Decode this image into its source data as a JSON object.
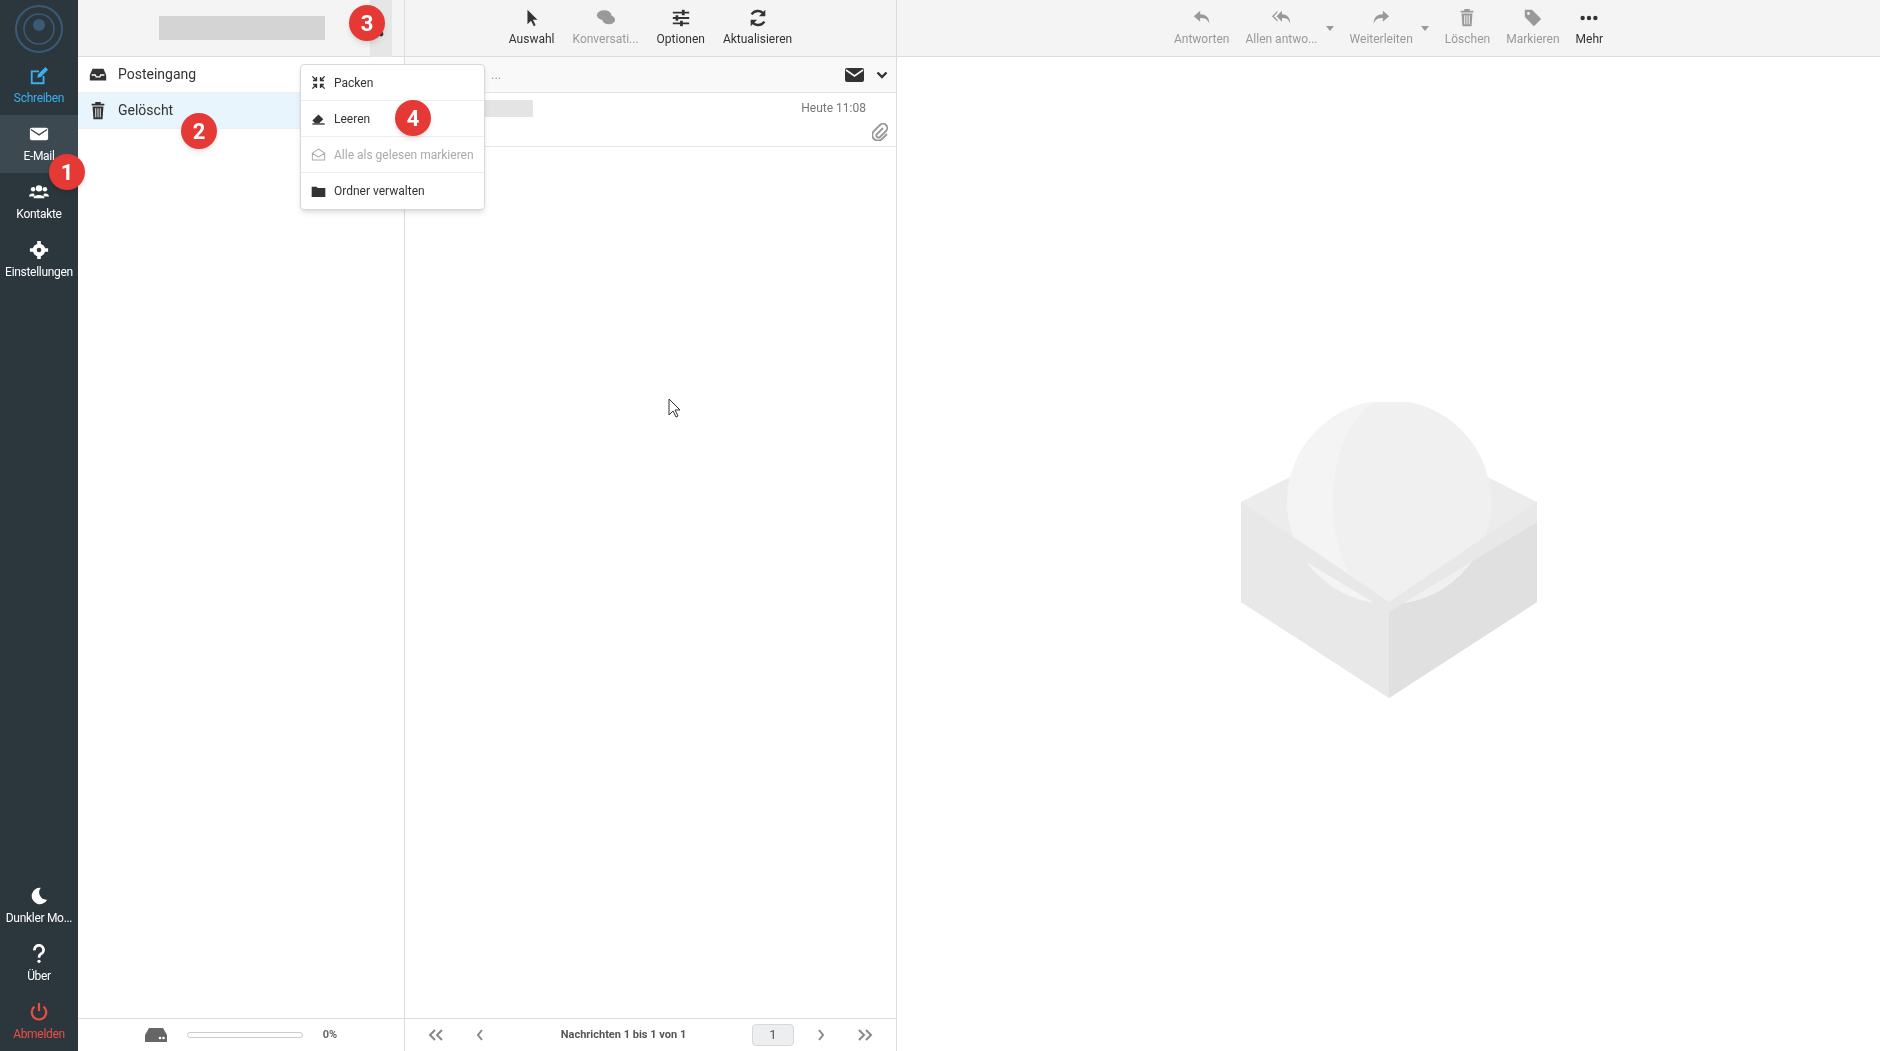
{
  "sidebar": {
    "items": [
      {
        "label": "Schreiben",
        "kind": "compose",
        "selected": false
      },
      {
        "label": "E-Mail",
        "kind": "mail",
        "selected": true
      },
      {
        "label": "Kontakte",
        "kind": "contacts",
        "selected": false
      },
      {
        "label": "Einstellungen",
        "kind": "settings",
        "selected": false
      }
    ],
    "bottom_items": [
      {
        "label": "Dunkler Mo...",
        "kind": "moon"
      },
      {
        "label": "Über",
        "kind": "help"
      },
      {
        "label": "Abmelden",
        "kind": "logout"
      }
    ]
  },
  "folders": [
    {
      "label": "Posteingang",
      "kind": "inbox",
      "selected": false
    },
    {
      "label": "Gelöscht",
      "kind": "trash",
      "selected": true
    }
  ],
  "folder_menu": [
    {
      "label": "Packen",
      "kind": "compress",
      "disabled": false
    },
    {
      "label": "Leeren",
      "kind": "eraser",
      "disabled": false
    },
    {
      "label": "Alle als gelesen markieren",
      "kind": "envelope-open",
      "disabled": true
    },
    {
      "label": "Ordner verwalten",
      "kind": "folder",
      "disabled": false
    }
  ],
  "list_toolbar": [
    {
      "label": "Auswahl",
      "kind": "pointer",
      "disabled": false
    },
    {
      "label": "Konversati...",
      "kind": "chat",
      "disabled": true
    },
    {
      "label": "Optionen",
      "kind": "sliders",
      "disabled": false
    },
    {
      "label": "Aktualisieren",
      "kind": "refresh",
      "disabled": false
    }
  ],
  "search": {
    "placeholder": "..."
  },
  "messages": [
    {
      "time": "Heute 11:08",
      "attachment": true
    }
  ],
  "preview_toolbar": [
    {
      "label": "Antworten",
      "kind": "reply",
      "disabled": true,
      "dropdown": false
    },
    {
      "label": "Allen antwo...",
      "kind": "reply-all",
      "disabled": true,
      "dropdown": true
    },
    {
      "label": "Weiterleiten",
      "kind": "forward",
      "disabled": true,
      "dropdown": true
    },
    {
      "label": "Löschen",
      "kind": "trash",
      "disabled": true,
      "dropdown": false
    },
    {
      "label": "Markieren",
      "kind": "tag",
      "disabled": true,
      "dropdown": false
    },
    {
      "label": "Mehr",
      "kind": "more",
      "disabled": false,
      "dropdown": false
    }
  ],
  "quota": {
    "level": 0,
    "reading": "0%"
  },
  "pagination": {
    "summary": "Nachrichten 1 bis 1 von 1",
    "page": "1"
  },
  "annotations": [
    "1",
    "2",
    "3",
    "4"
  ]
}
